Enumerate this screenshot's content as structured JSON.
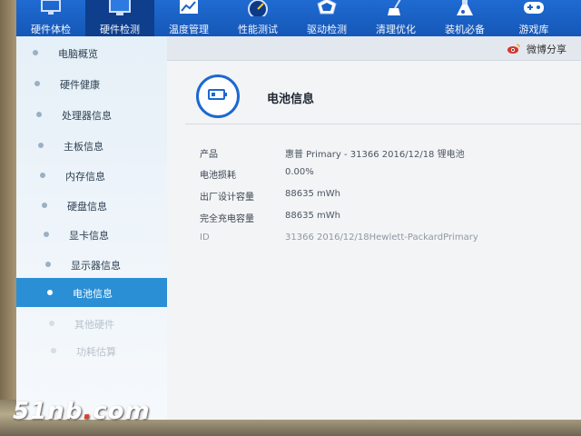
{
  "nav": {
    "items": [
      {
        "label": "硬件体检",
        "icon": "monitor-icon"
      },
      {
        "label": "硬件检测",
        "icon": "pc-monitor-icon"
      },
      {
        "label": "温度管理",
        "icon": "temperature-chart-icon"
      },
      {
        "label": "性能测试",
        "icon": "speedometer-icon"
      },
      {
        "label": "驱动检测",
        "icon": "driver-shield-icon"
      },
      {
        "label": "清理优化",
        "icon": "broom-icon"
      },
      {
        "label": "装机必备",
        "icon": "flask-icon"
      },
      {
        "label": "游戏库",
        "icon": "gamepad-icon"
      }
    ],
    "active_index": 1,
    "colors": {
      "bar": "#1a62c8",
      "active": "#0e3e8c"
    }
  },
  "sidebar": {
    "items": [
      {
        "label": "电脑概览"
      },
      {
        "label": "硬件健康"
      },
      {
        "label": "处理器信息"
      },
      {
        "label": "主板信息"
      },
      {
        "label": "内存信息"
      },
      {
        "label": "硬盘信息"
      },
      {
        "label": "显卡信息"
      },
      {
        "label": "显示器信息"
      },
      {
        "label": "电池信息"
      },
      {
        "label": "其他硬件"
      },
      {
        "label": "功耗估算"
      }
    ],
    "active_index": 8,
    "active_color": "#2b8fd6"
  },
  "toolbar": {
    "share_label": "微博分享",
    "share_icon": "weibo-icon"
  },
  "section": {
    "title": "电池信息",
    "icon": "battery-icon"
  },
  "battery_info": {
    "rows": [
      {
        "key": "产品",
        "value": "惠普 Primary - 31366 2016/12/18 锂电池"
      },
      {
        "key": "电池损耗",
        "value": "0.00%"
      },
      {
        "key": "出厂设计容量",
        "value": "88635 mWh"
      },
      {
        "key": "完全充电容量",
        "value": "88635 mWh"
      },
      {
        "key": "ID",
        "value": "31366 2016/12/18Hewlett-PackardPrimary"
      }
    ]
  },
  "watermark": {
    "prefix": "51nb",
    "dot": ".",
    "suffix": "com"
  }
}
